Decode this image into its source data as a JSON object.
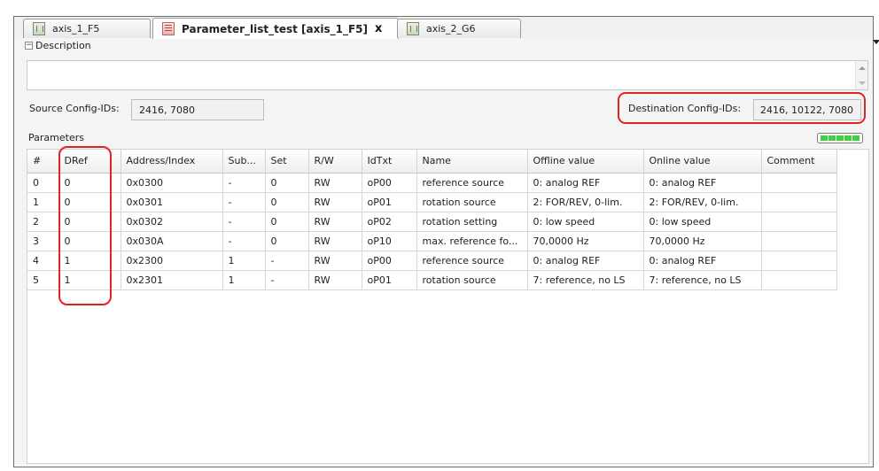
{
  "tabs": [
    {
      "label": "axis_1_F5",
      "active": false,
      "icon": "device-icon"
    },
    {
      "label": "Parameter_list_test [axis_1_F5]",
      "active": true,
      "icon": "parameter-list-icon",
      "close": "x"
    },
    {
      "label": "axis_2_G6",
      "active": false,
      "icon": "device-icon"
    }
  ],
  "description": {
    "header": "Description",
    "collapse_glyph": "−",
    "value": ""
  },
  "source_config": {
    "label": "Source Config-IDs:",
    "value": "2416, 7080"
  },
  "destination_config": {
    "label": "Destination Config-IDs:",
    "value": "2416, 10122, 7080"
  },
  "parameters": {
    "label": "Parameters",
    "columns": [
      "#",
      "DRef",
      "Address/Index",
      "Sub...",
      "Set",
      "R/W",
      "IdTxt",
      "Name",
      "Offline value",
      "Online value",
      "Comment"
    ],
    "rows": [
      [
        "0",
        "0",
        "0x0300",
        "-",
        "0",
        "RW",
        "oP00",
        "reference source",
        "0: analog REF",
        "0: analog REF",
        ""
      ],
      [
        "1",
        "0",
        "0x0301",
        "-",
        "0",
        "RW",
        "oP01",
        "rotation source",
        "2: FOR/REV, 0-lim.",
        "2: FOR/REV, 0-lim.",
        ""
      ],
      [
        "2",
        "0",
        "0x0302",
        "-",
        "0",
        "RW",
        "oP02",
        "rotation setting",
        "0: low speed",
        "0: low speed",
        ""
      ],
      [
        "3",
        "0",
        "0x030A",
        "-",
        "0",
        "RW",
        "oP10",
        "max. reference fo...",
        "70,0000 Hz",
        "70,0000 Hz",
        ""
      ],
      [
        "4",
        "1",
        "0x2300",
        "1",
        "-",
        "RW",
        "oP00",
        "reference source",
        "0: analog REF",
        "0: analog REF",
        ""
      ],
      [
        "5",
        "1",
        "0x2301",
        "1",
        "-",
        "RW",
        "oP01",
        "rotation source",
        "7: reference, no LS",
        "7: reference, no LS",
        ""
      ]
    ]
  },
  "colors": {
    "highlight": "#e02424",
    "progress": "#3fd13f",
    "frame": "#6e6e6e"
  }
}
